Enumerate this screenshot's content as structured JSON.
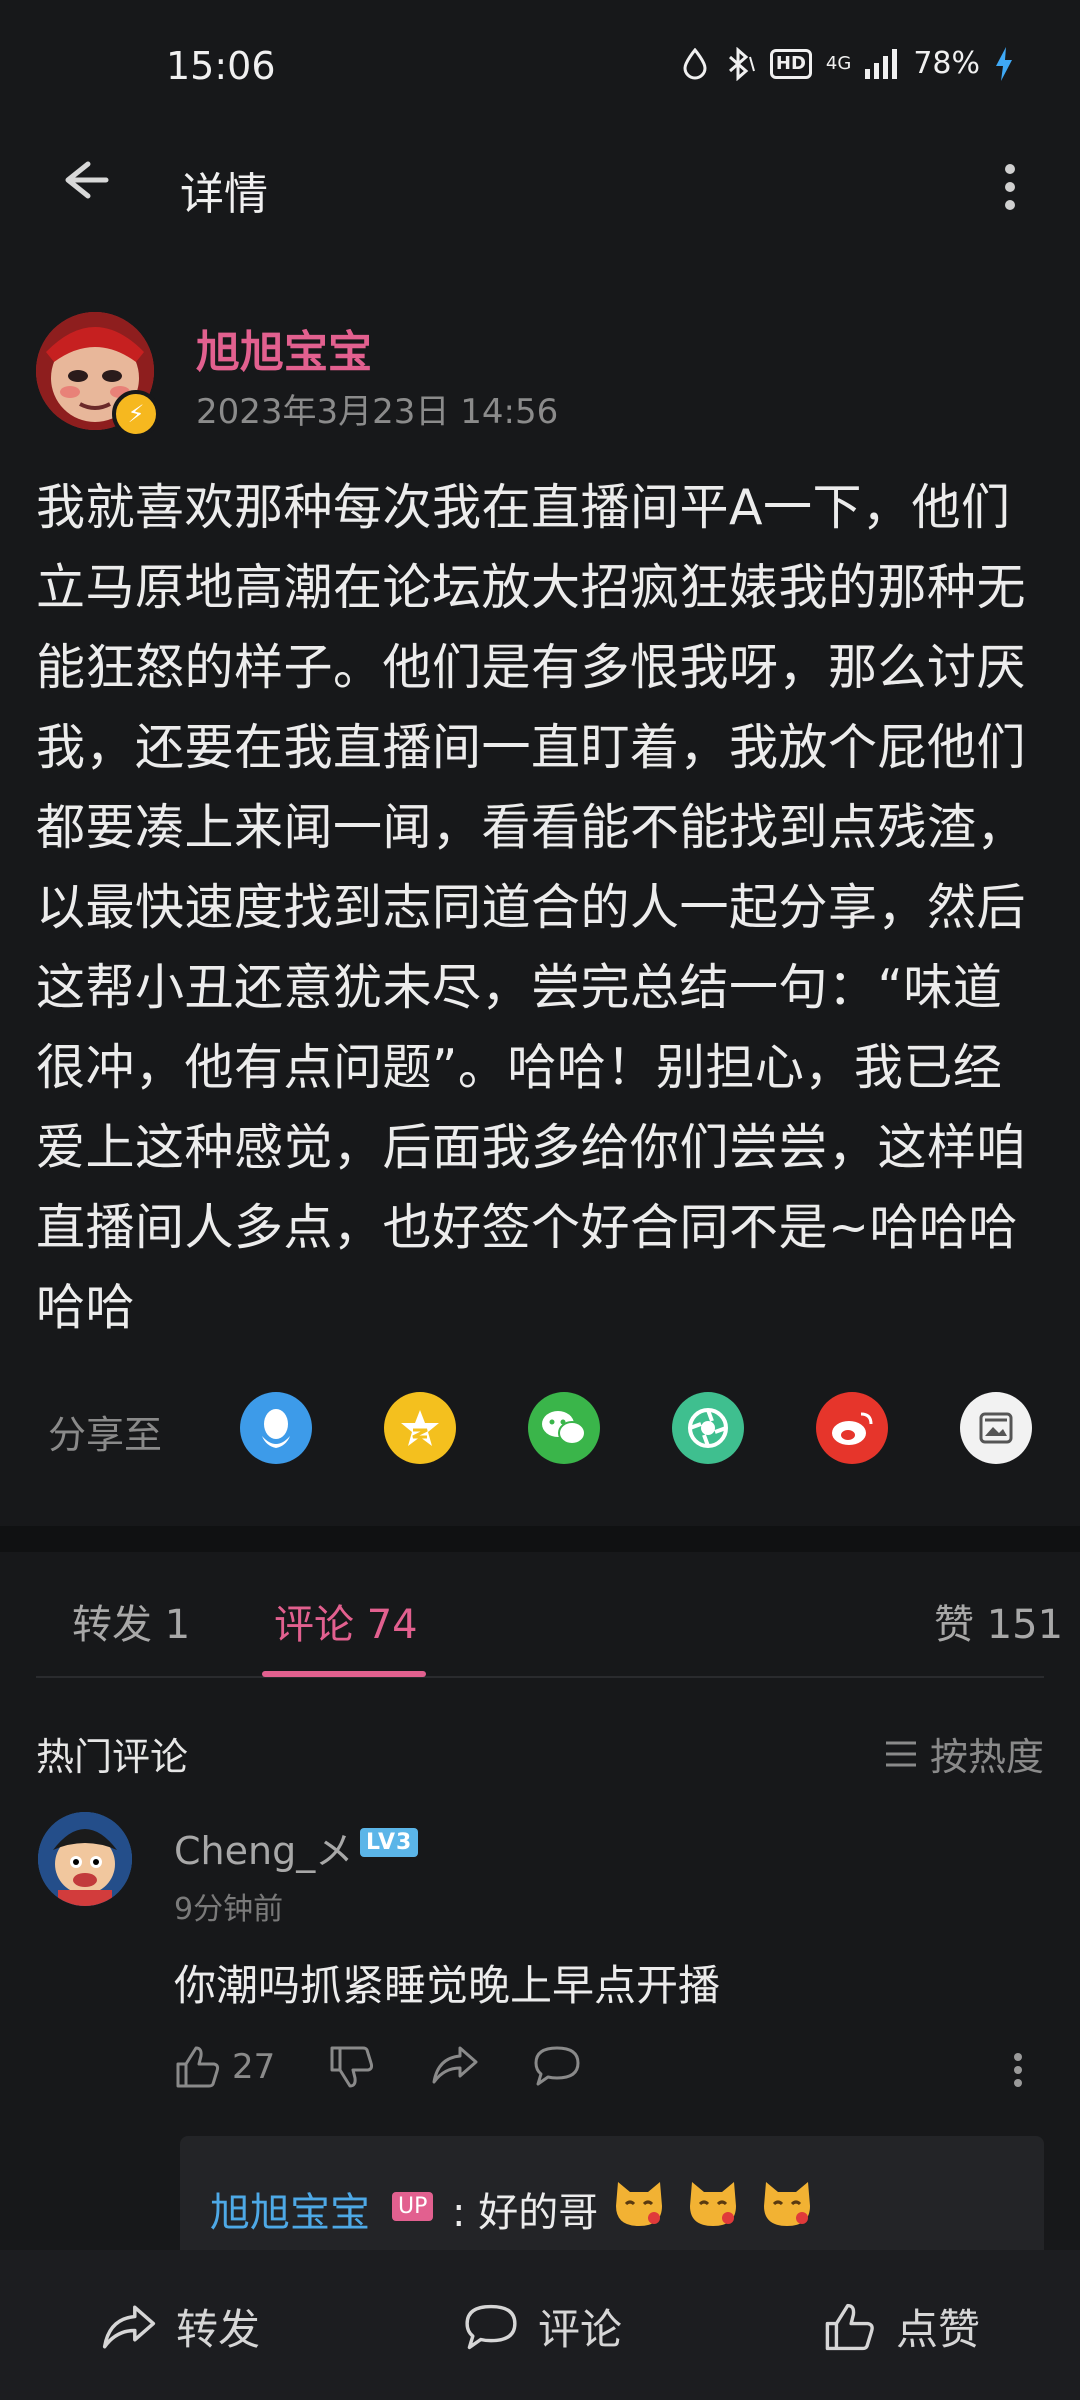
{
  "status_bar": {
    "time": "15:06",
    "battery": "78%",
    "network": "4G",
    "hd_label": "HD"
  },
  "header": {
    "title": "详情"
  },
  "post": {
    "author": "旭旭宝宝",
    "time": "2023年3月23日 14:56",
    "body": "我就喜欢那种每次我在直播间平A一下，他们立马原地高潮在论坛放大招疯狂婊我的那种无能狂怒的样子。他们是有多恨我呀，那么讨厌我，还要在我直播间一直盯着，我放个屁他们都要凑上来闻一闻，看看能不能找到点残渣，以最快速度找到志同道合的人一起分享，然后这帮小丑还意犹未尽，尝完总结一句：“味道很冲，他有点问题”。哈哈！别担心，我已经爱上这种感觉，后面我多给你们尝尝，这样咱直播间人多点，也好签个好合同不是~哈哈哈哈哈"
  },
  "share": {
    "label": "分享至",
    "targets": [
      {
        "name": "qq",
        "color": "#3d9be9"
      },
      {
        "name": "qzone",
        "color": "#f4c01e"
      },
      {
        "name": "wechat",
        "color": "#3ab54a"
      },
      {
        "name": "moments",
        "color": "#3fbf8f"
      },
      {
        "name": "weibo",
        "color": "#e6352b"
      },
      {
        "name": "image",
        "color": "#f2f2f2"
      }
    ]
  },
  "tabs": {
    "repost": "转发 1",
    "comments": "评论 74",
    "likes": "赞 151"
  },
  "comments_section": {
    "title": "热门评论",
    "sort_label": "按热度"
  },
  "comment": {
    "user": "Cheng_メ",
    "level": "LV3",
    "time": "9分钟前",
    "text": "你潮吗抓紧睡觉晚上早点开播",
    "like_count": "27"
  },
  "reply": {
    "user": "旭旭宝宝",
    "up_badge": "UP",
    "text": ": 好的哥"
  },
  "bottom_bar": {
    "repost": "转发",
    "comment": "评论",
    "like": "点赞"
  }
}
